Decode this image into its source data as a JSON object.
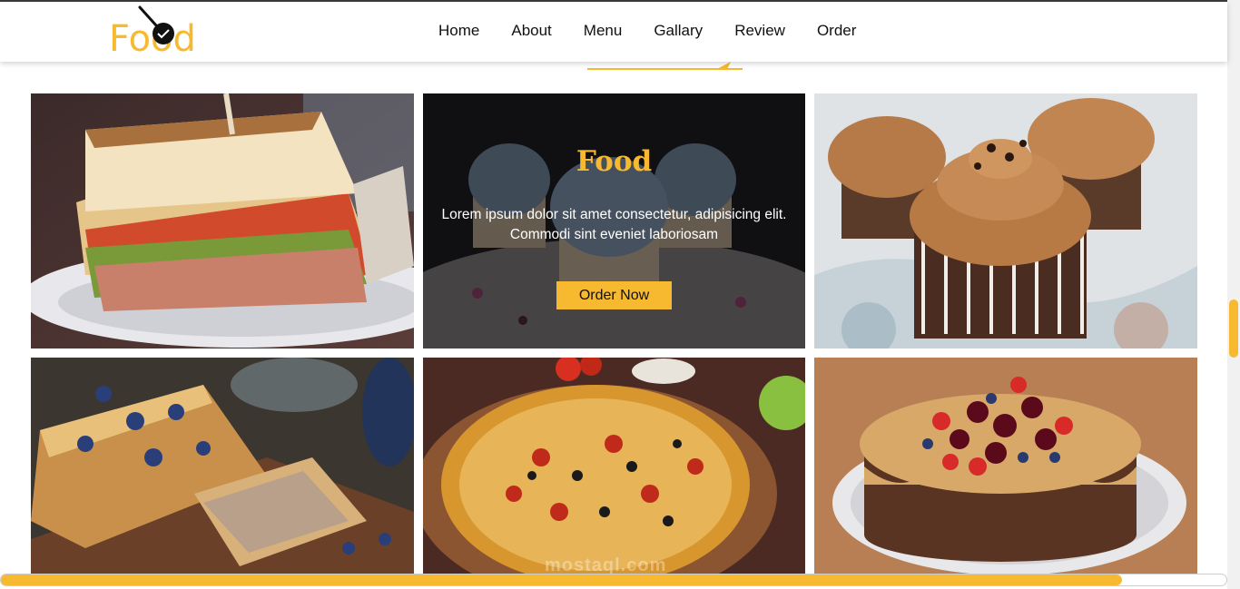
{
  "brand": {
    "logo_text": "Food",
    "accent_color": "#f7b92f"
  },
  "nav": {
    "items": [
      {
        "label": "Home"
      },
      {
        "label": "About"
      },
      {
        "label": "Menu"
      },
      {
        "label": "Gallary"
      },
      {
        "label": "Review"
      },
      {
        "label": "Order"
      }
    ]
  },
  "gallery": {
    "items": [
      {
        "name": "sandwich"
      },
      {
        "name": "blue-cupcakes",
        "overlay": {
          "title": "Food",
          "text": "Lorem ipsum dolor sit amet consectetur, adipisicing elit. Commodi sint eveniet laboriosam",
          "button": "Order Now"
        }
      },
      {
        "name": "chocolate-cupcakes"
      },
      {
        "name": "blueberry-loaf"
      },
      {
        "name": "pizza"
      },
      {
        "name": "berry-cake"
      }
    ]
  },
  "watermark": "mostaql.com",
  "scroll": {
    "horizontal_progress": 0.915
  }
}
